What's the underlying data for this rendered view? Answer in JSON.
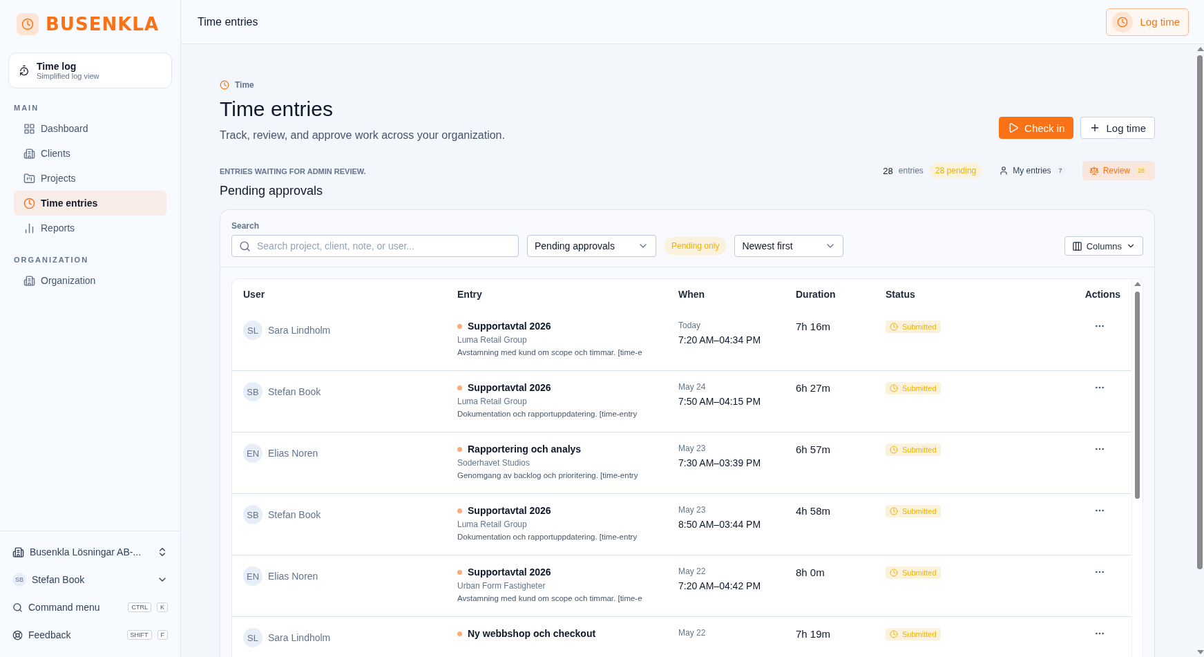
{
  "brand": {
    "name": "BUSENKLA"
  },
  "quick_link": {
    "title": "Time log",
    "subtitle": "Simplified log view"
  },
  "sidebar": {
    "sections": [
      {
        "label": "MAIN",
        "items": [
          {
            "label": "Dashboard",
            "selected": false
          },
          {
            "label": "Clients",
            "selected": false
          },
          {
            "label": "Projects",
            "selected": false
          },
          {
            "label": "Time entries",
            "selected": true
          },
          {
            "label": "Reports",
            "selected": false
          }
        ]
      },
      {
        "label": "ORGANIZATION",
        "items": [
          {
            "label": "Organization",
            "selected": false
          }
        ]
      }
    ]
  },
  "org_switcher": {
    "label": "Busenkla Lösningar AB-..."
  },
  "account": {
    "initials": "SB",
    "name": "Stefan Book"
  },
  "shortcuts": [
    {
      "label": "Command menu",
      "keys": [
        "CTRL",
        "K"
      ]
    },
    {
      "label": "Feedback",
      "keys": [
        "SHIFT",
        "F"
      ]
    }
  ],
  "header": {
    "title": "Time entries",
    "button": "Log time"
  },
  "page": {
    "breadcrumb": "Time",
    "title": "Time entries",
    "subtitle": "Track, review, and approve work across your organization.",
    "actions": [
      {
        "label": "Check in",
        "kind": "primary"
      },
      {
        "label": "Log time",
        "kind": "secondary"
      }
    ]
  },
  "section": {
    "eyebrow": "ENTRIES WAITING FOR ADMIN REVIEW.",
    "title": "Pending approvals",
    "count": "28",
    "count_label": "entries",
    "pending": "28 pending",
    "views": [
      {
        "label": "My entries",
        "count": "7",
        "selected": false
      },
      {
        "label": "Review",
        "count": "28",
        "selected": true
      }
    ]
  },
  "filters": {
    "search_label": "Search",
    "search_placeholder": "Search project, client, note, or user...",
    "scope": "Pending approvals",
    "pending_tag": "Pending only",
    "sort": "Newest first",
    "columns_button": "Columns"
  },
  "table": {
    "columns": [
      "User",
      "Entry",
      "When",
      "Duration",
      "Status",
      "Actions"
    ],
    "rows": [
      {
        "initials": "SL",
        "user": "Sara Lindholm",
        "project": "Supportavtal 2026",
        "client": "Luma Retail Group",
        "note": "Avstamning med kund om scope och timmar. [time-e",
        "day": "Today",
        "time": "7:20 AM–04:34 PM",
        "duration": "7h 16m",
        "status": "Submitted"
      },
      {
        "initials": "SB",
        "user": "Stefan Book",
        "project": "Supportavtal 2026",
        "client": "Luma Retail Group",
        "note": "Dokumentation och rapportuppdatering. [time-entry",
        "day": "May 24",
        "time": "7:50 AM–04:15 PM",
        "duration": "6h 27m",
        "status": "Submitted"
      },
      {
        "initials": "EN",
        "user": "Elias Noren",
        "project": "Rapportering och analys",
        "client": "Soderhavet Studios",
        "note": "Genomgang av backlog och prioritering. [time-entry",
        "day": "May 23",
        "time": "7:30 AM–03:39 PM",
        "duration": "6h 57m",
        "status": "Submitted"
      },
      {
        "initials": "SB",
        "user": "Stefan Book",
        "project": "Supportavtal 2026",
        "client": "Luma Retail Group",
        "note": "Dokumentation och rapportuppdatering. [time-entry",
        "day": "May 23",
        "time": "8:50 AM–03:44 PM",
        "duration": "4h 58m",
        "status": "Submitted"
      },
      {
        "initials": "EN",
        "user": "Elias Noren",
        "project": "Supportavtal 2026",
        "client": "Urban Form Fastigheter",
        "note": "Avstamning med kund om scope och timmar. [time-e",
        "day": "May 22",
        "time": "7:20 AM–04:42 PM",
        "duration": "8h 0m",
        "status": "Submitted"
      },
      {
        "initials": "SL",
        "user": "Sara Lindholm",
        "project": "Ny webbshop och checkout",
        "day": "May 22",
        "duration": "7h 19m",
        "status": "Submitted"
      }
    ]
  }
}
